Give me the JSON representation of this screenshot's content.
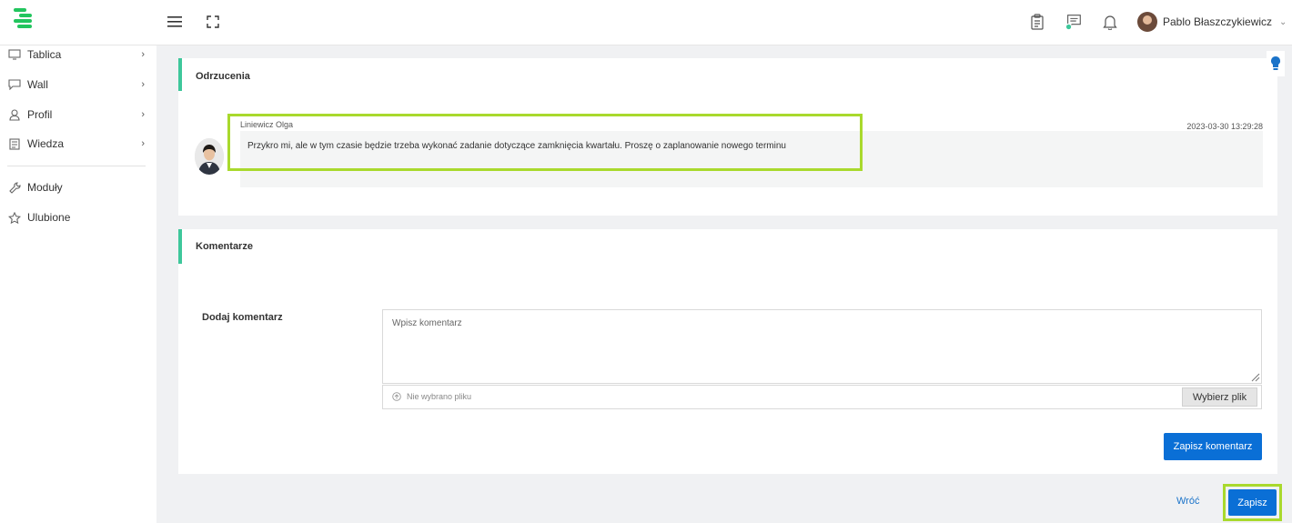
{
  "header": {
    "user_name": "Pablo Błaszczykiewicz",
    "icons": [
      "menu-icon",
      "fullscreen-icon",
      "clipboard-icon",
      "chat-icon",
      "bell-icon"
    ]
  },
  "sidebar": {
    "items": [
      {
        "label": "Tablica",
        "icon": "monitor-icon"
      },
      {
        "label": "Wall",
        "icon": "chat-bubble-icon"
      },
      {
        "label": "Profil",
        "icon": "user-icon"
      },
      {
        "label": "Wiedza",
        "icon": "document-icon"
      },
      {
        "label": "Moduły",
        "icon": "wrench-icon"
      },
      {
        "label": "Ulubione",
        "icon": "star-icon"
      }
    ]
  },
  "rejections": {
    "title": "Odrzucenia",
    "comment": {
      "author": "Liniewicz Olga",
      "date": "2023-03-30 13:29:28",
      "text": "Przykro mi, ale w tym czasie będzie trzeba wykonać zadanie dotyczące zamknięcia kwartału. Proszę o zaplanowanie nowego terminu"
    }
  },
  "comments": {
    "title": "Komentarze",
    "add_label": "Dodaj komentarz",
    "placeholder": "Wpisz komentarz",
    "file_status": "Nie wybrano pliku",
    "choose_file": "Wybierz plik",
    "save_comment": "Zapisz komentarz"
  },
  "footer": {
    "back": "Wróć",
    "save": "Zapisz"
  },
  "colors": {
    "accent": "#3ec79b",
    "primary": "#0a6fd6",
    "highlight": "#a9d92d",
    "logo": "#22c55e"
  }
}
